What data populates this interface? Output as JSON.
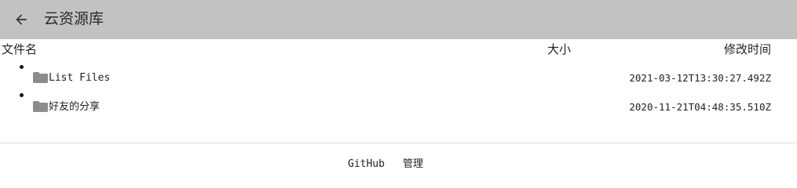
{
  "header": {
    "title": "云资源库",
    "back_icon": "arrow-left-icon"
  },
  "table": {
    "columns": {
      "name": "文件名",
      "size": "大小",
      "modified": "修改时间"
    },
    "rows": [
      {
        "icon": "folder-icon",
        "name": "List Files",
        "size": "",
        "modified": "2021-03-12T13:30:27.492Z"
      },
      {
        "icon": "folder-icon",
        "name": "好友的分享",
        "size": "",
        "modified": "2020-11-21T04:48:35.510Z"
      }
    ]
  },
  "footer": {
    "github_label": "GitHub",
    "admin_label": "管理"
  },
  "colors": {
    "topbar": "#c2c2c2",
    "folder": "#8c8c8c"
  }
}
